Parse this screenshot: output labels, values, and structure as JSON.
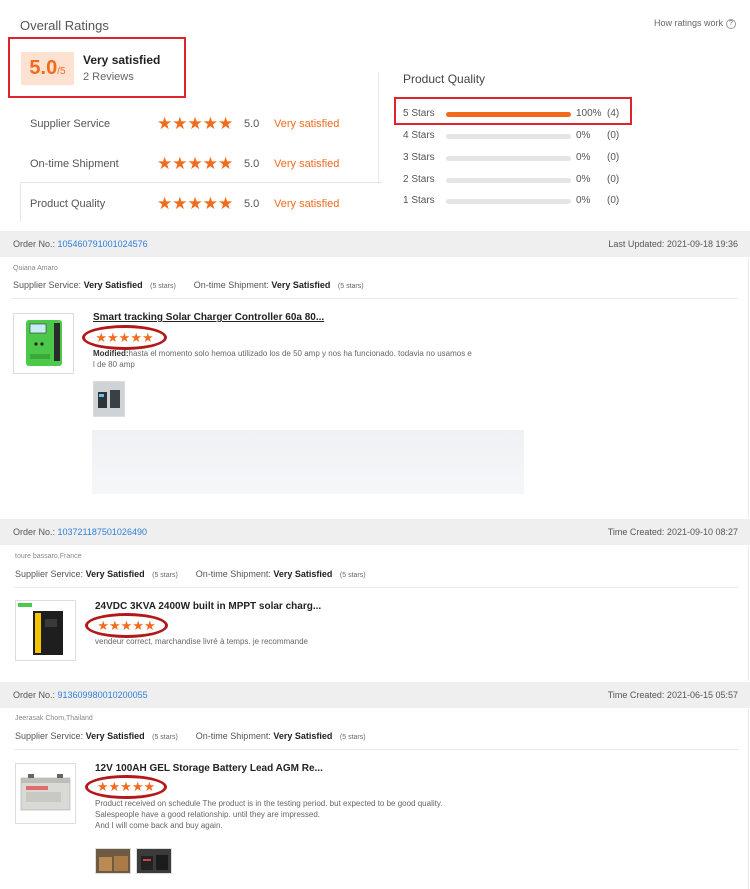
{
  "overall": {
    "title": "Overall Ratings",
    "how_ratings": "How ratings work",
    "score": "5.0",
    "score_max": "/5",
    "label": "Very satisfied",
    "reviews": "2 Reviews",
    "criteria": [
      {
        "name": "Supplier Service",
        "stars": "★★★★★",
        "value": "5.0",
        "verdict": "Very satisfied"
      },
      {
        "name": "On-time Shipment",
        "stars": "★★★★★",
        "value": "5.0",
        "verdict": "Very satisfied"
      },
      {
        "name": "Product Quality",
        "stars": "★★★★★",
        "value": "5.0",
        "verdict": "Very satisfied"
      }
    ]
  },
  "product_quality": {
    "title": "Product Quality",
    "rows": [
      {
        "label": "5 Stars",
        "fraction": 1.0,
        "pct": "100%",
        "count": "(4)"
      },
      {
        "label": "4 Stars",
        "fraction": 0,
        "pct": "0%",
        "count": "(0)"
      },
      {
        "label": "3 Stars",
        "fraction": 0,
        "pct": "0%",
        "count": "(0)"
      },
      {
        "label": "2 Stars",
        "fraction": 0,
        "pct": "0%",
        "count": "(0)"
      },
      {
        "label": "1 Stars",
        "fraction": 0,
        "pct": "0%",
        "count": "(0)"
      }
    ]
  },
  "orders": [
    {
      "order_label": "Order No.:",
      "order_no": "105460791001024576",
      "date": "Last Updated: 2021-09-18 19:36",
      "reviewer": "Quiana Amaro",
      "supplier_label": "Supplier Service:",
      "supplier_value": "Very Satisfied",
      "supplier_stars": "(5 stars)",
      "shipment_label": "On-time Shipment:",
      "shipment_value": "Very Satisfied",
      "shipment_stars": "(5 stars)",
      "product_title": "Smart tracking Solar Charger Controller 60a 80...",
      "stars": "★★★★★",
      "modified_label": "Modified:",
      "review_line1": "hasta el momento solo hemoa utilizado los de 50 amp y nos ha funcionado. todavia no usamos e",
      "review_line2": "l de 80 amp"
    },
    {
      "order_label": "Order No.:",
      "order_no": "103721187501026490",
      "date": "Time Created: 2021-09-10 08:27",
      "reviewer": "toure bassaro,France",
      "supplier_label": "Supplier Service:",
      "supplier_value": "Very Satisfied",
      "supplier_stars": "(5 stars)",
      "shipment_label": "On-time Shipment:",
      "shipment_value": "Very Satisfied",
      "shipment_stars": "(5 stars)",
      "product_title": "24VDC 3KVA 2400W built in MPPT solar charg...",
      "stars": "★★★★★",
      "review_line1": "vendeur correct, marchandise livré à temps. je recommande"
    },
    {
      "order_label": "Order No.:",
      "order_no": "913609980010200055",
      "date": "Time Created: 2021-06-15 05:57",
      "reviewer": "Jeerasak Chom,Thailand",
      "supplier_label": "Supplier Service:",
      "supplier_value": "Very Satisfied",
      "supplier_stars": "(5 stars)",
      "shipment_label": "On-time Shipment:",
      "shipment_value": "Very Satisfied",
      "shipment_stars": "(5 stars)",
      "product_title": "12V 100AH GEL Storage Battery Lead AGM Re...",
      "stars": "★★★★★",
      "review_line1": "Product received on schedule The product is in the testing period. but expected to be good quality.",
      "review_line2": "Salespeople have a good relationship. until they are impressed.",
      "review_line3": "And I will come back and buy again."
    }
  ],
  "colors": {
    "accent": "#f26b1d",
    "highlight_box": "#e0242b",
    "link": "#2f7ed8"
  }
}
